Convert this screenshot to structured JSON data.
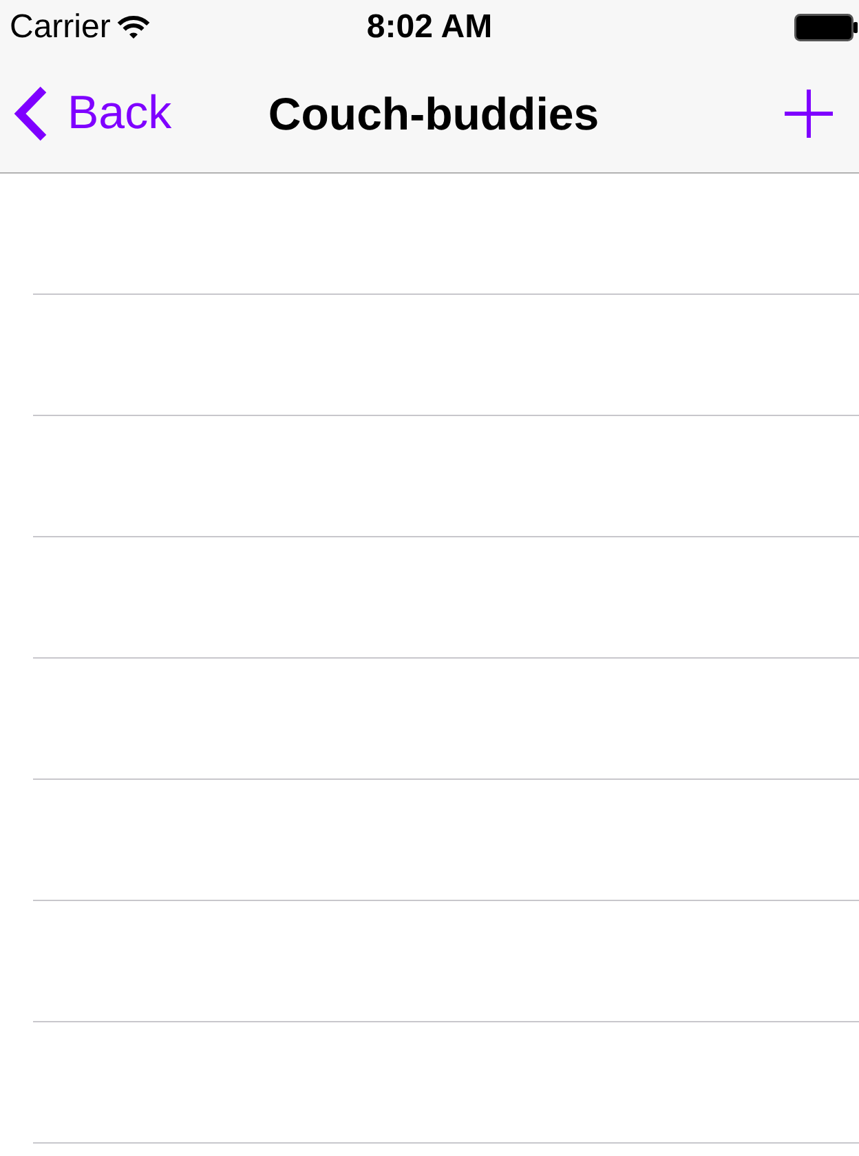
{
  "status_bar": {
    "carrier": "Carrier",
    "time": "8:02 AM"
  },
  "navigation_bar": {
    "back_button": {
      "label": "Back"
    },
    "title": "Couch-buddies"
  },
  "table": {
    "rows": [
      {
        "kind": "empty"
      },
      {
        "kind": "empty"
      },
      {
        "kind": "empty"
      },
      {
        "kind": "empty"
      },
      {
        "kind": "empty"
      },
      {
        "kind": "empty"
      },
      {
        "kind": "empty"
      },
      {
        "kind": "empty"
      }
    ]
  }
}
